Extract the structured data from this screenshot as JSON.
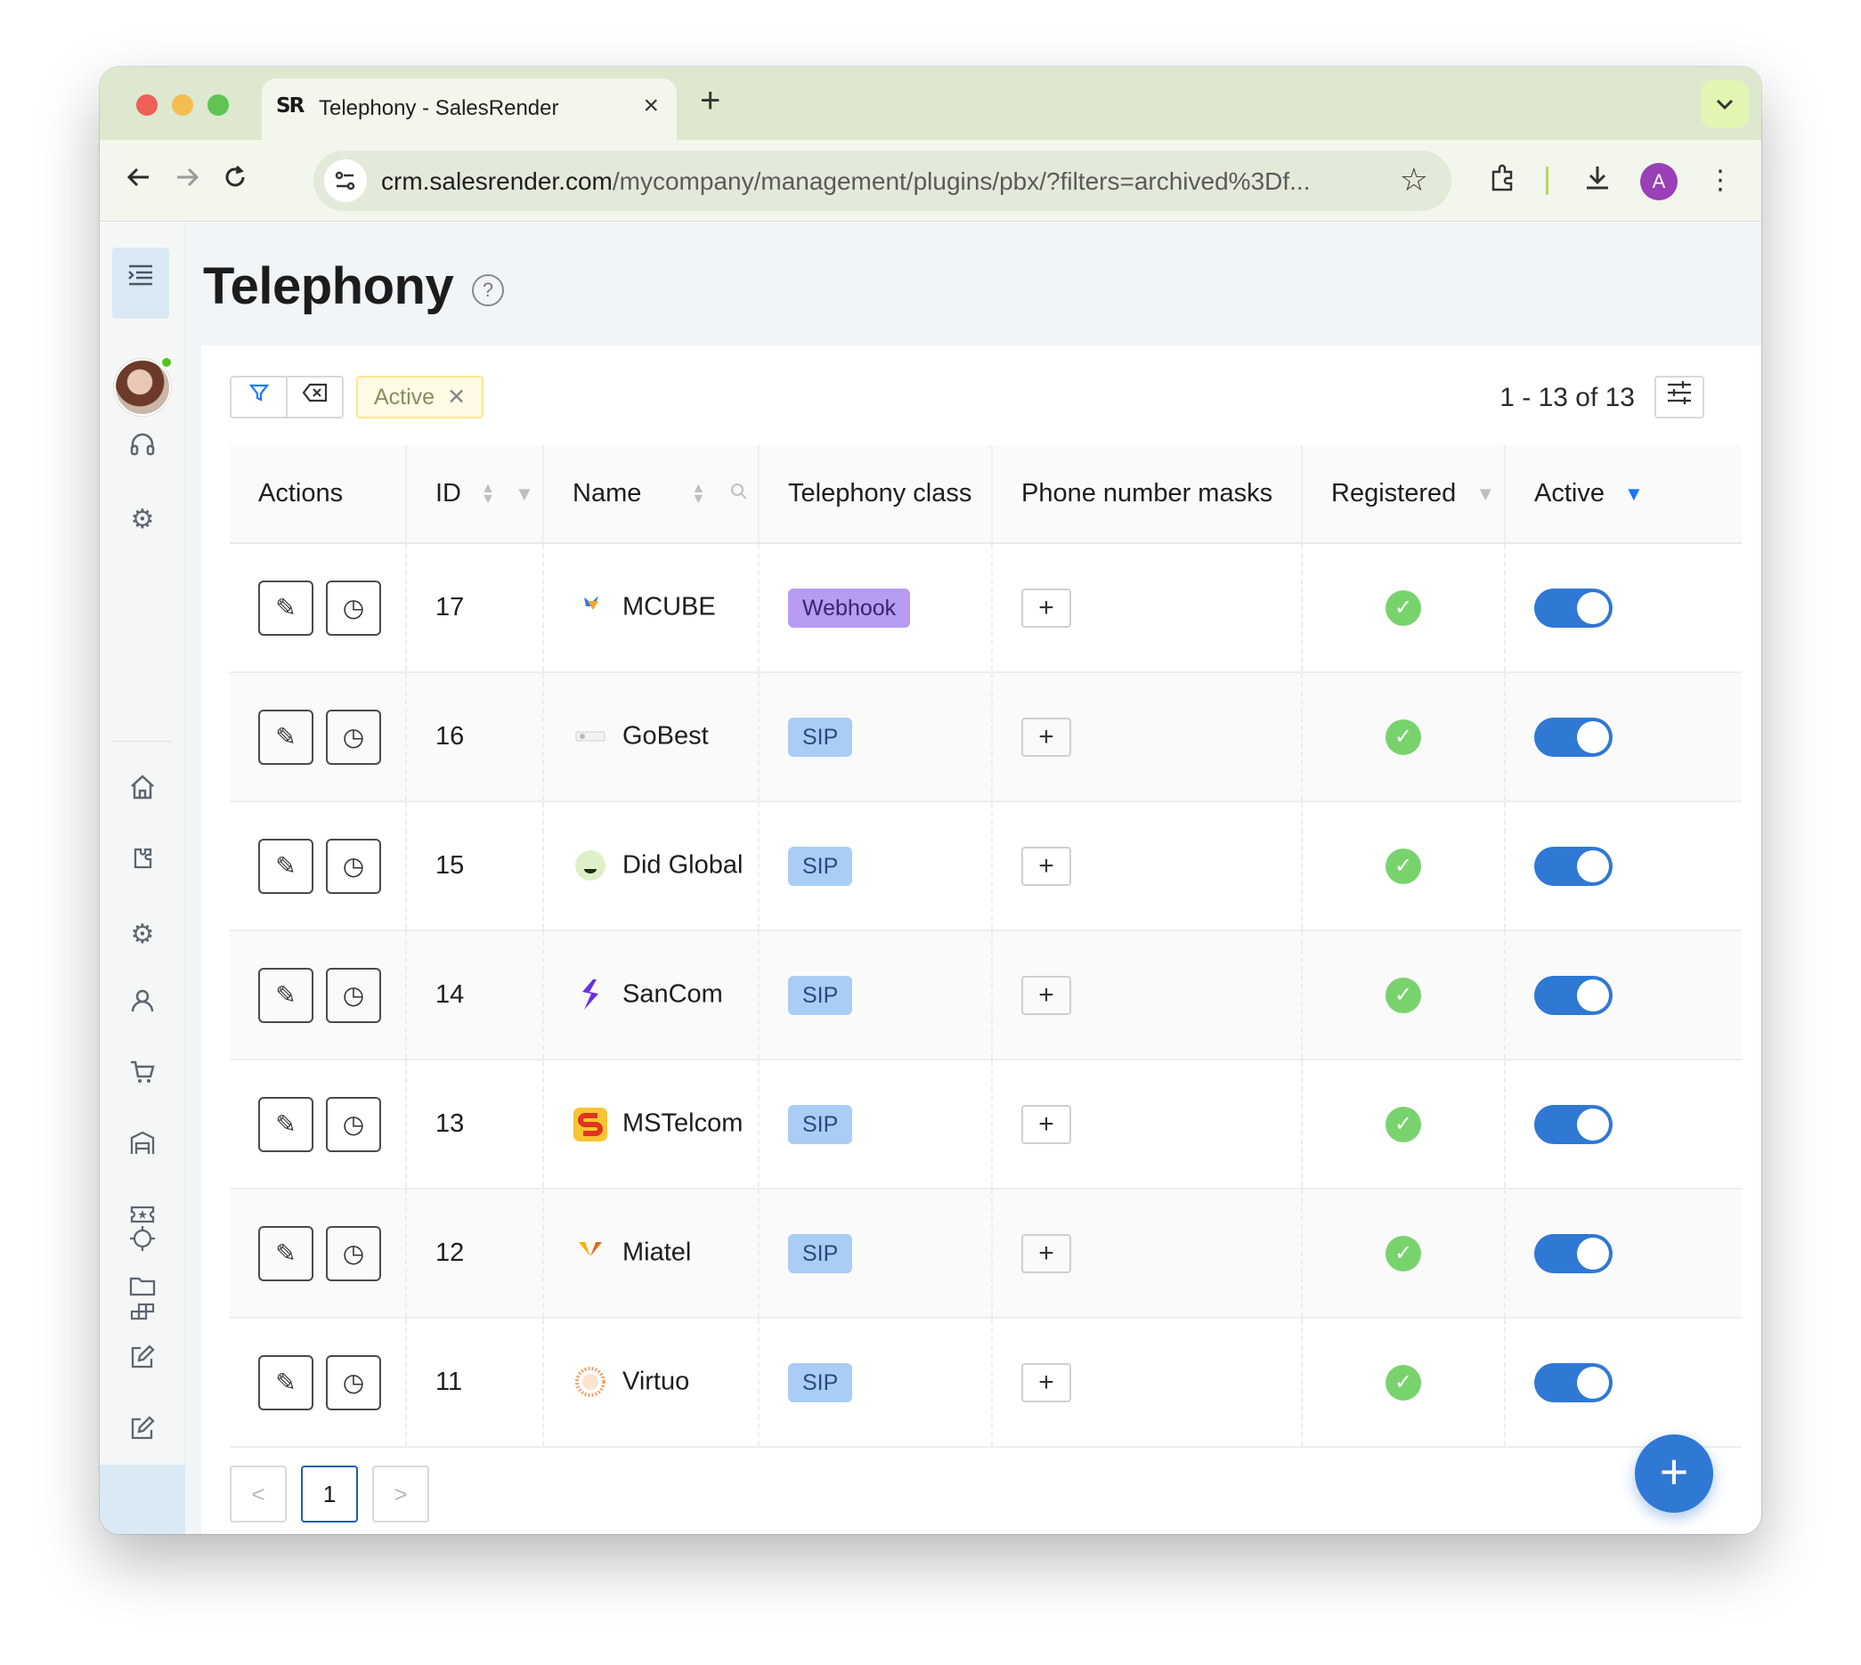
{
  "browser": {
    "tab_title": "Telephony - SalesRender",
    "favicon_text": "SR",
    "url_host": "crm.salesrender.com",
    "url_path": "/mycompany/management/plugins/pbx/?filters=archived%3Df...",
    "profile_initial": "A"
  },
  "page": {
    "title": "Telephony",
    "active_filter_chip": "Active",
    "range_text": "1 - 13 of 13"
  },
  "table": {
    "columns": [
      "Actions",
      "ID",
      "Name",
      "Telephony class",
      "Phone number masks",
      "Registered",
      "Active"
    ],
    "rows": [
      {
        "id": "17",
        "name": "MCUBE",
        "class": "Webhook",
        "logo": "mcube-logo",
        "registered": true,
        "active": true
      },
      {
        "id": "16",
        "name": "GoBest",
        "class": "SIP",
        "logo": "gobest-logo",
        "registered": true,
        "active": true
      },
      {
        "id": "15",
        "name": "Did Global",
        "class": "SIP",
        "logo": "did-global-logo",
        "registered": true,
        "active": true
      },
      {
        "id": "14",
        "name": "SanCom",
        "class": "SIP",
        "logo": "sancom-logo",
        "registered": true,
        "active": true
      },
      {
        "id": "13",
        "name": "MSTelcom",
        "class": "SIP",
        "logo": "mstelcom-logo",
        "registered": true,
        "active": true
      },
      {
        "id": "12",
        "name": "Miatel",
        "class": "SIP",
        "logo": "miatel-logo",
        "registered": true,
        "active": true
      },
      {
        "id": "11",
        "name": "Virtuo",
        "class": "SIP",
        "logo": "virtuo-logo",
        "registered": true,
        "active": true
      }
    ]
  },
  "pagination": {
    "prev": "<",
    "current": "1",
    "next": ">"
  },
  "colors": {
    "accent": "#2f78d4",
    "sip_badge": "#a9cdf5",
    "webhook_badge": "#b79cf2",
    "registered": "#78d36d",
    "chip_bg": "#fffbe6"
  }
}
